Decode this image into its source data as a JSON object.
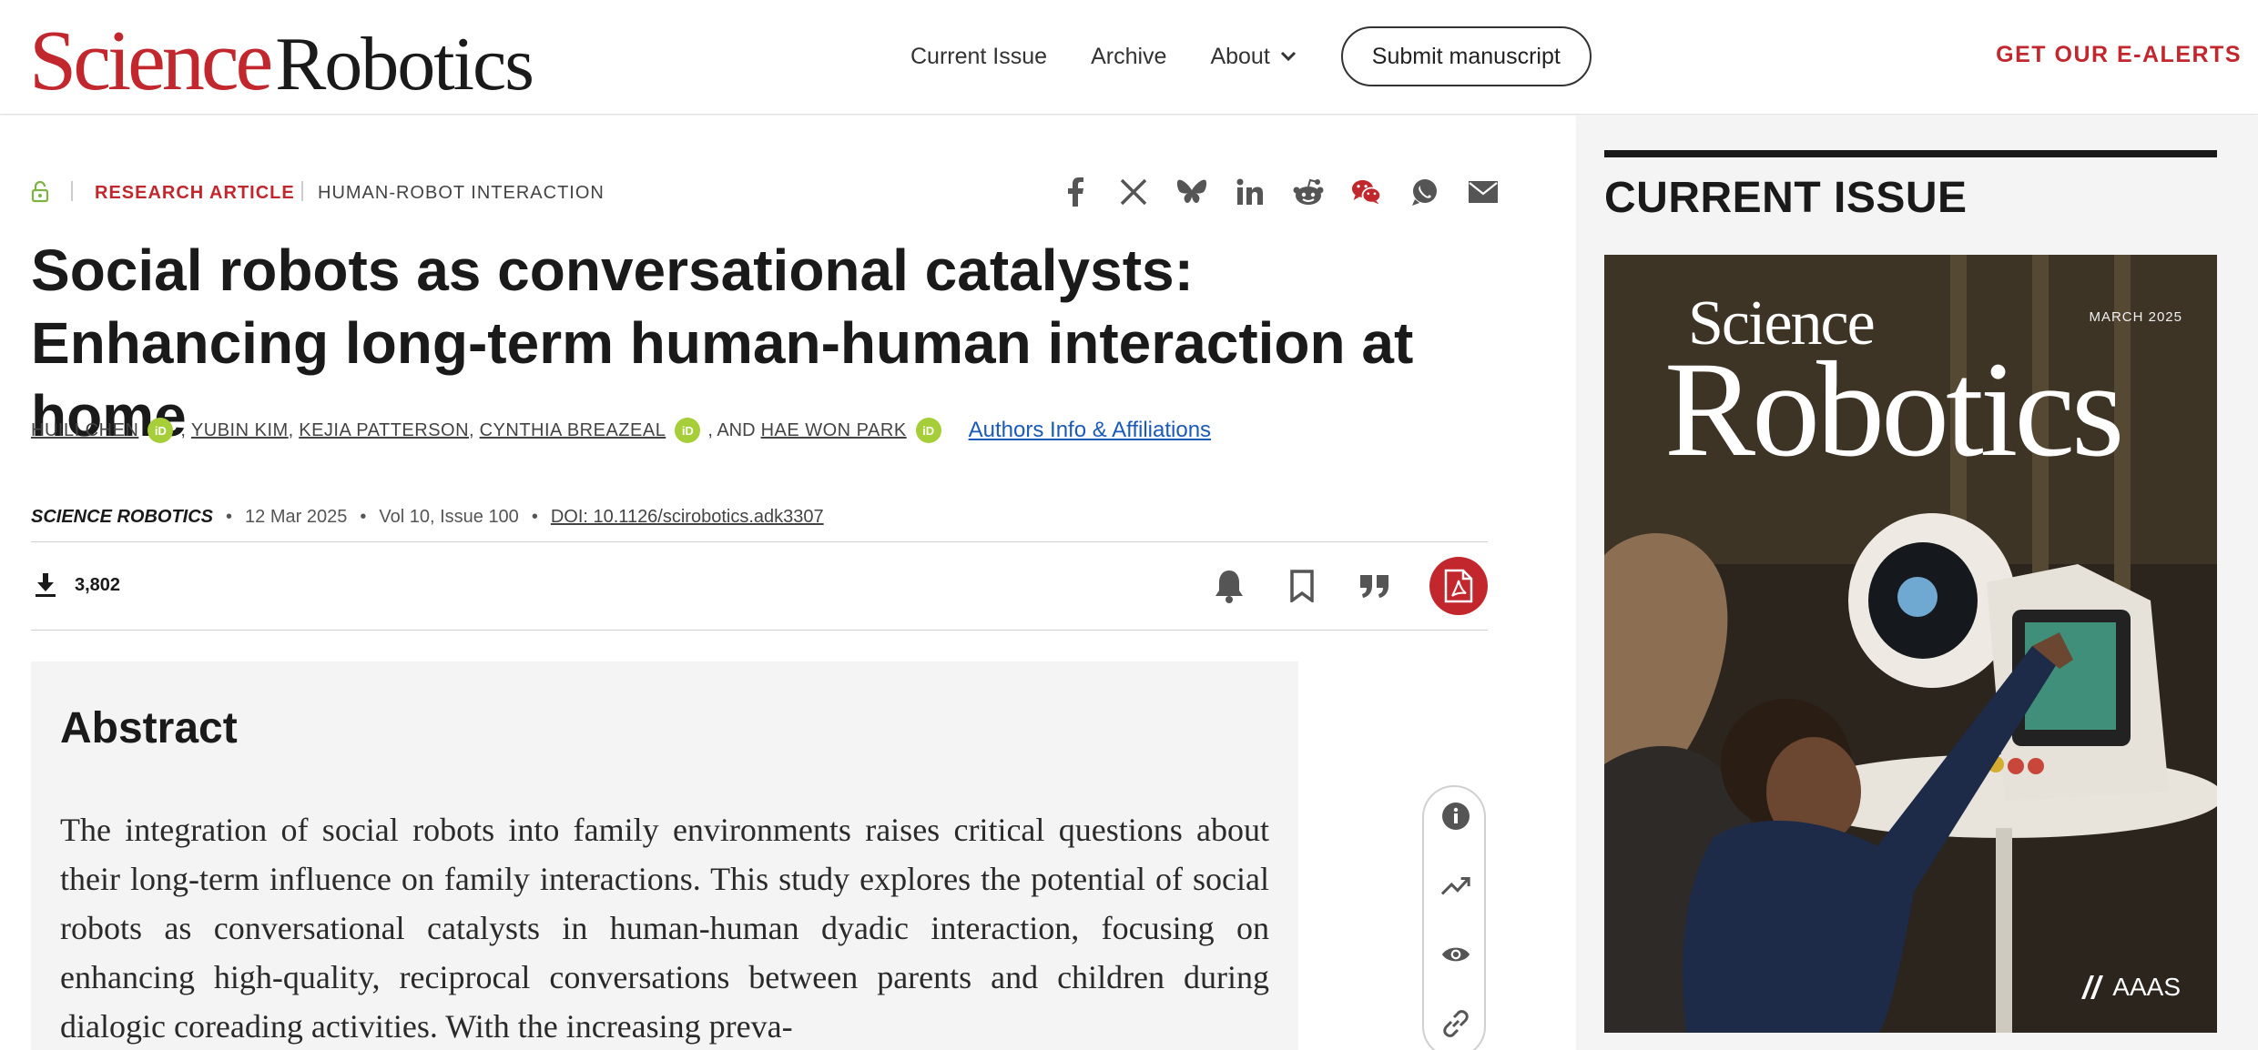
{
  "header": {
    "logo_science": "Science",
    "logo_robotics": "Robotics",
    "nav": {
      "current_issue": "Current Issue",
      "archive": "Archive",
      "about": "About"
    },
    "submit_label": "Submit manuscript",
    "ealerts_label": "GET OUR E-ALERTS"
  },
  "article": {
    "type": "RESEARCH ARTICLE",
    "subject": "HUMAN-ROBOT INTERACTION",
    "title": "Social robots as conversational catalysts: Enhancing long-term human-human interaction at home",
    "authors": [
      "HUILI CHEN",
      "YUBIN KIM",
      "KEJIA PATTERSON",
      "CYNTHIA BREAZEAL",
      "HAE WON PARK"
    ],
    "and_label": ", AND",
    "comma": ",",
    "orcid_label": "iD",
    "affiliations_link": "Authors Info & Affiliations",
    "journal": "SCIENCE ROBOTICS",
    "date": "12 Mar 2025",
    "volume": "Vol 10, Issue 100",
    "doi": "DOI: 10.1126/scirobotics.adk3307",
    "bullet": "•",
    "downloads": "3,802"
  },
  "abstract": {
    "heading": "Abstract",
    "text": "The integration of social robots into family environments raises critical questions about their long-term influence on family interactions. This study explores the potential of social robots as conversational catalysts in human-human dyadic interaction, focusing on enhancing high-quality, reciprocal conversations between parents and children during dialogic coreading activities. With the increasing preva-"
  },
  "sidebar": {
    "heading": "CURRENT ISSUE",
    "cover_science": "Science",
    "cover_robotics": "Robotics",
    "cover_date": "MARCH 2025",
    "cover_publisher": "AAAS"
  },
  "colors": {
    "brand_red": "#c1272d",
    "orcid_green": "#a6ce39",
    "link_blue": "#1a5ab8"
  },
  "icons": {
    "share": [
      "facebook-icon",
      "x-icon",
      "bluesky-icon",
      "linkedin-icon",
      "reddit-icon",
      "wechat-icon",
      "whatsapp-icon",
      "email-icon"
    ],
    "tools": [
      "bell-icon",
      "bookmark-icon",
      "quote-icon",
      "pdf-icon"
    ],
    "floating": [
      "info-icon",
      "trending-icon",
      "eye-icon",
      "link-icon"
    ]
  }
}
